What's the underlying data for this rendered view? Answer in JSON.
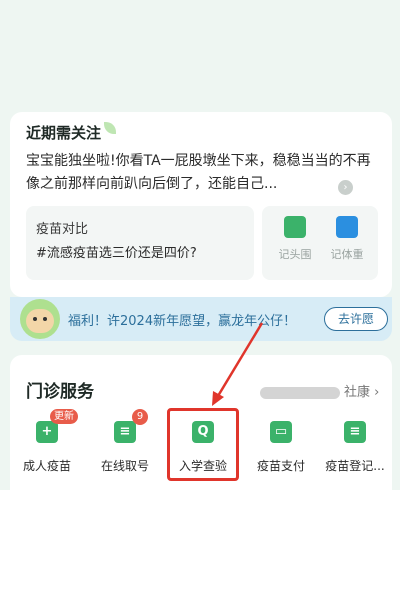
{
  "attention": {
    "title": "近期需关注",
    "body": "宝宝能独坐啦!你看TA一屁股墩坐下来，稳稳当当的不再像之前那样向前趴向后倒了，还能自己...",
    "compare_title": "疫苗对比",
    "compare_tag": "#流感疫苗选三价还是四价?",
    "tools": [
      {
        "label": "记头围",
        "icon": "ruler-icon",
        "color": "#3bb26a"
      },
      {
        "label": "记体重",
        "icon": "scale-icon",
        "color": "#2b8fe0"
      }
    ]
  },
  "benefit": {
    "text": "福利！许2024新年愿望，赢龙年公仔！",
    "button": "去许愿"
  },
  "clinic": {
    "title": "门诊服务",
    "hospital_suffix": "社康",
    "chevron": "›",
    "services": [
      {
        "label": "成人疫苗",
        "icon": "plus-icon",
        "glyph": "+",
        "badge": "更新"
      },
      {
        "label": "在线取号",
        "icon": "ticket-icon",
        "glyph": "≡",
        "badge": "9"
      },
      {
        "label": "入学查验",
        "icon": "search-icon",
        "glyph": "Q",
        "badge": ""
      },
      {
        "label": "疫苗支付",
        "icon": "card-icon",
        "glyph": "▭",
        "badge": ""
      },
      {
        "label": "疫苗登记...",
        "icon": "clipboard-icon",
        "glyph": "≡",
        "badge": ""
      }
    ]
  },
  "colors": {
    "accent": "#3bb26a",
    "highlight": "#e0352b",
    "banner_text": "#2c6f9b"
  }
}
